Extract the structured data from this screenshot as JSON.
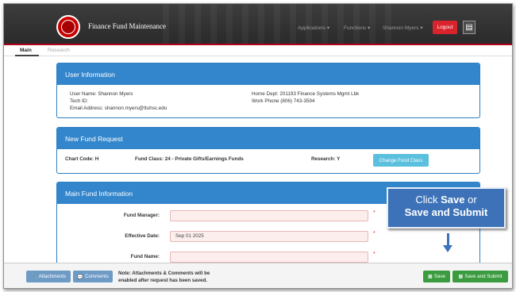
{
  "header": {
    "app_title": "Finance Fund Maintenance",
    "nav": [
      "Applications ▾",
      "Functions ▾",
      "Shannon Myers ▾"
    ],
    "logout_label": "Logout"
  },
  "tabs": {
    "main": "Main",
    "research": "Research"
  },
  "user_info": {
    "title": "User Information",
    "user_name": "User Name: Shannon Myers",
    "tech_id": "Tech ID:",
    "email": "Email Address: shannon.myers@ttuhsc.edu",
    "home_dept": "Home Dept: 201193 Finance Systems Mgmt Lbk",
    "work_phone": "Work Phone (806) 743-3594"
  },
  "new_fund": {
    "title": "New Fund Request",
    "chart_code": "Chart Code: H",
    "fund_class": "Fund Class: 24 - Private Gifts/Earnings Funds",
    "research": "Research: Y",
    "change_label": "Change Fund Class"
  },
  "main_fund": {
    "title": "Main Fund Information",
    "manager_label": "Fund Manager:",
    "manager_value": "",
    "date_label": "Effective Date:",
    "date_value": "Sep 01 2025",
    "name_label": "Fund Name:",
    "name_value": "",
    "required_mark": "*"
  },
  "callout": {
    "line1_a": "Click ",
    "line1_b": "Save",
    "line1_c": " or",
    "line2": "Save and Submit"
  },
  "footer": {
    "attachments": "Attachments",
    "comments": "Comments",
    "note_line1": "Note: Attachments & Comments will be",
    "note_line2": "enabled after request has been saved.",
    "save": "Save",
    "save_submit": "Save and Submit"
  },
  "colors": {
    "panel_header": "#3386cc",
    "brand_red": "#d9232d",
    "success": "#3a9b3f",
    "callout": "#3d72b8"
  },
  "icons": [
    "university-seal-icon",
    "document-icon",
    "paperclip-icon",
    "comment-icon",
    "save-icon"
  ]
}
